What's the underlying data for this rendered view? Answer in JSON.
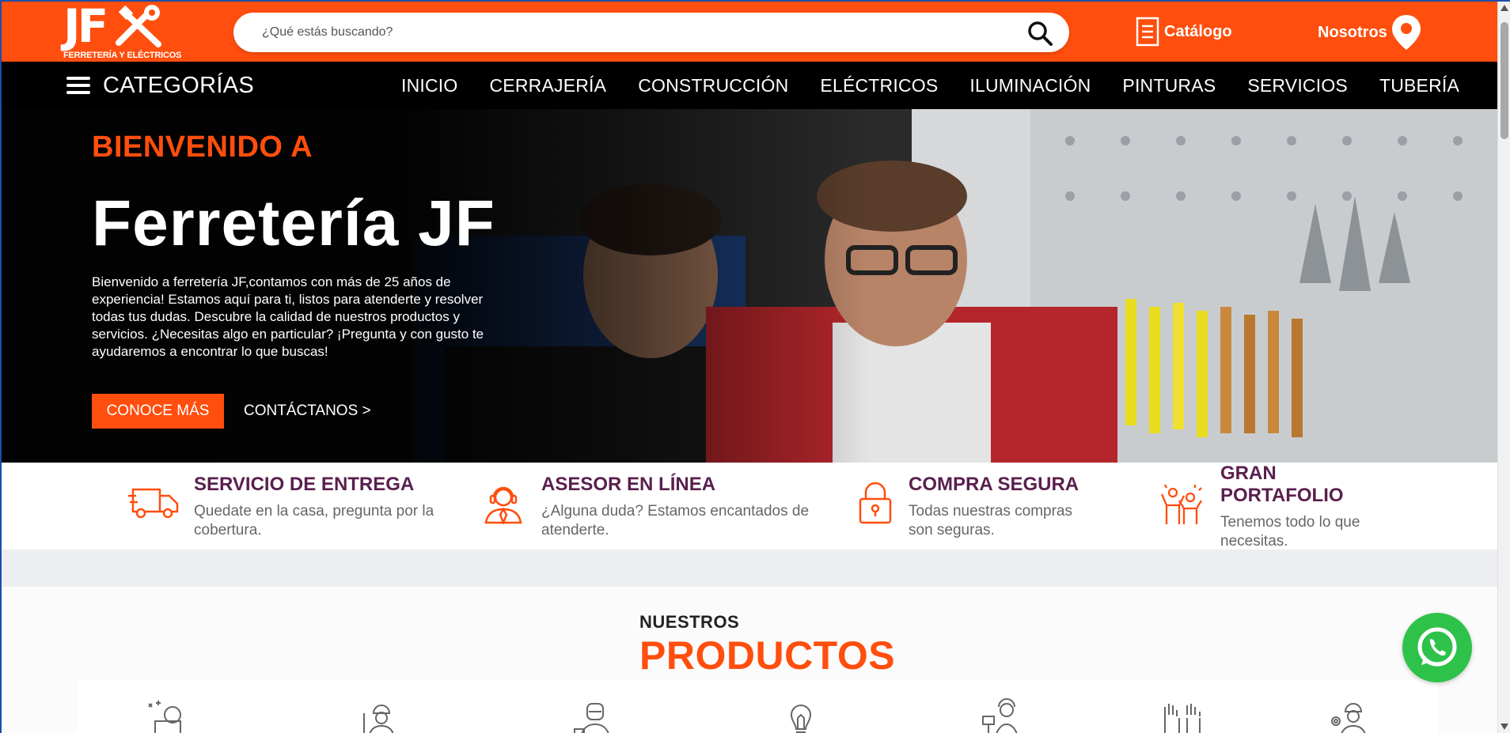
{
  "brand": {
    "logo_text": "JF",
    "logo_subtitle": "FERRETERÍA Y ELÉCTRICOS",
    "accent_color": "#ff4e0d",
    "nav_bg": "#000000",
    "title_color": "#5a1f4e"
  },
  "header": {
    "search_placeholder": "¿Qué estás buscando?",
    "search_icon": "search-icon",
    "catalog_label": "Catálogo",
    "catalog_icon": "document-icon",
    "about_label": "Nosotros",
    "about_icon": "map-pin-icon"
  },
  "nav": {
    "categories_label": "CATEGORÍAS",
    "menu_icon": "hamburger-icon",
    "links": [
      "INICIO",
      "CERRAJERÍA",
      "CONSTRUCCIÓN",
      "ELÉCTRICOS",
      "ILUMINACIÓN",
      "PINTURAS",
      "SERVICIOS",
      "TUBERÍA"
    ]
  },
  "hero": {
    "kicker": "BIENVENIDO A",
    "title": "Ferretería JF",
    "text": "Bienvenido a ferretería JF,contamos con más de 25 años de experiencia! Estamos aquí para ti, listos para atenderte y resolver todas tus dudas. Descubre la calidad de nuestros productos y servicios. ¿Necesitas algo en particular? ¡Pregunta y con gusto te ayudaremos a encontrar lo que buscas!",
    "primary_button": "CONOCE MÁS",
    "secondary_button": "CONTÁCTANOS >"
  },
  "features": [
    {
      "title": "SERVICIO DE ENTREGA",
      "desc": "Quedate en la casa, pregunta por la cobertura.",
      "icon": "delivery-truck-icon"
    },
    {
      "title": "ASESOR EN LÍNEA",
      "desc": "¿Alguna duda? Estamos encantados de atenderte.",
      "icon": "support-agent-icon"
    },
    {
      "title": "COMPRA SEGURA",
      "desc": "Todas nuestras compras son seguras.",
      "icon": "padlock-icon"
    },
    {
      "title": "GRAN PORTAFOLIO",
      "desc": "Tenemos todo lo que necesitas.",
      "icon": "celebration-people-icon"
    }
  ],
  "products": {
    "kicker": "NUESTROS",
    "title": "PRODUCTOS",
    "category_icons": [
      "cleaning-tools-icon",
      "construction-worker-icon",
      "welder-icon",
      "light-bulb-icon",
      "painter-icon",
      "gloves-icon",
      "engineer-icon"
    ]
  },
  "floating": {
    "whatsapp_icon": "whatsapp-icon",
    "whatsapp_color": "#2fc24a"
  }
}
